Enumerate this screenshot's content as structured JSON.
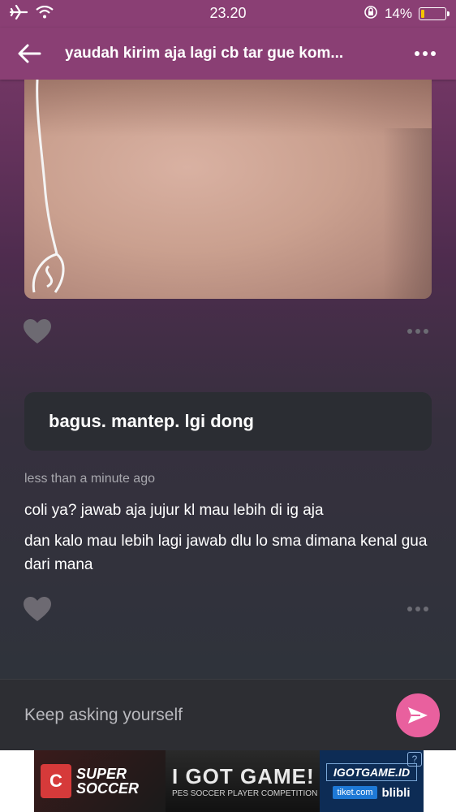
{
  "status_bar": {
    "time": "23.20",
    "battery_percent_label": "14%",
    "battery_level": 0.14,
    "icons": [
      "airplane-icon",
      "wifi-icon",
      "rotation-lock-icon",
      "battery-icon"
    ]
  },
  "header": {
    "title": "yaudah kirim aja lagi cb tar gue kom...",
    "back_icon": "arrow-left-icon",
    "more_icon": "more-horizontal-icon"
  },
  "question": {
    "text": "bagus. mantep. lgi dong"
  },
  "answer": {
    "timestamp": "less than a minute ago",
    "lines": [
      "coli ya? jawab aja jujur kl mau lebih di ig aja",
      "dan kalo mau lebih lagi jawab dlu lo sma dimana kenal gua dari mana"
    ]
  },
  "composer": {
    "placeholder": "Keep asking yourself",
    "send_icon": "send-icon"
  },
  "ad": {
    "left_brand_line1": "SUPER",
    "left_brand_line2": "SOCCER",
    "mid_title": "I GOT GAME!",
    "mid_subtitle": "PES SOCCER PLAYER COMPETITION",
    "right_logo": "IGOTGAME.ID",
    "partner_1": "tiket.com",
    "partner_2": "blibli",
    "info_label": "?"
  },
  "colors": {
    "header_bg": "#8a3f74",
    "send_button": "#e9609e",
    "card_bg": "#2b2d33"
  }
}
